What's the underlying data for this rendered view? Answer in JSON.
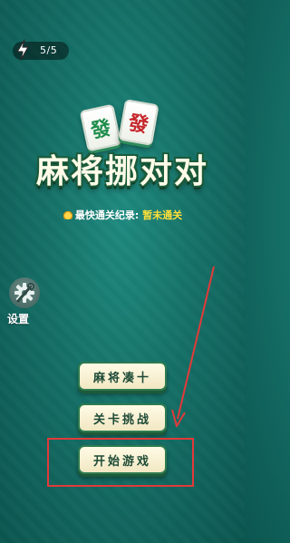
{
  "energy": {
    "count": "5/5",
    "icon": "lightning-bolt-icon"
  },
  "tiles": [
    {
      "glyph": "發",
      "color": "#1e8d4c"
    },
    {
      "glyph": "發",
      "color": "#c6262c"
    }
  ],
  "title": "麻将挪对对",
  "record": {
    "label": "最快通关纪录:",
    "value": "暂未通关",
    "icon": "medal-icon"
  },
  "settings": {
    "label": "设置",
    "icon": "gear-wrench-icon"
  },
  "menu": [
    {
      "label": "麻将凑十"
    },
    {
      "label": "关卡挑战"
    },
    {
      "label": "开始游戏"
    }
  ],
  "annotation": {
    "color": "#e23a3a"
  }
}
